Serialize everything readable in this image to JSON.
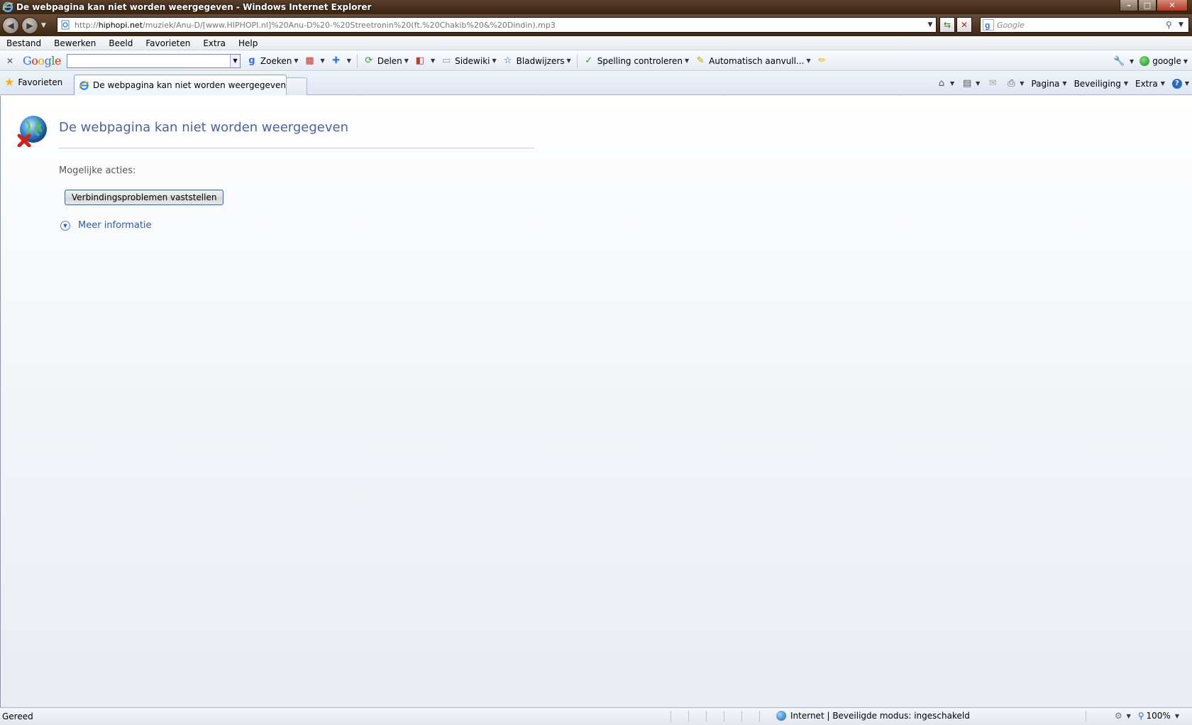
{
  "window": {
    "title": "De webpagina kan niet worden weergegeven - Windows Internet Explorer",
    "min_label": "–",
    "max_label": "□",
    "close_label": "✕"
  },
  "address_bar": {
    "url_host": "hiphopi.net",
    "url_prefix": "http://",
    "url_path": "/muziek/Anu-D/[www.HIPHOPI.nl]%20Anu-D%20-%20Streetronin%20(ft.%20Chakib%20&%20Dindin).mp3"
  },
  "search_box": {
    "placeholder": "Google"
  },
  "menu": [
    "Bestand",
    "Bewerken",
    "Beeld",
    "Favorieten",
    "Extra",
    "Help"
  ],
  "google_toolbar": {
    "zoeken": "Zoeken",
    "delen": "Delen",
    "sidewiki": "Sidewiki",
    "bladwijzers": "Bladwijzers",
    "spelling": "Spelling controleren",
    "autofill": "Automatisch aanvull...",
    "account": "google"
  },
  "tabs": {
    "favorites": "Favorieten",
    "active_tab": "De webpagina kan niet worden weergegeven"
  },
  "command_bar": {
    "pagina": "Pagina",
    "beveiliging": "Beveiliging",
    "extra": "Extra"
  },
  "content": {
    "error_title": "De webpagina kan niet worden weergegeven",
    "actions_label": "Mogelijke acties:",
    "diagnose_button": "Verbindingsproblemen vaststellen",
    "more_info": "Meer informatie"
  },
  "status_bar": {
    "status": "Gereed",
    "zone": "Internet | Beveiligde modus: ingeschakeld",
    "zoom": "100%"
  },
  "colors": {
    "title_bar": "#3a2414",
    "error_title": "#4863a0",
    "link": "#2f5aa8"
  }
}
